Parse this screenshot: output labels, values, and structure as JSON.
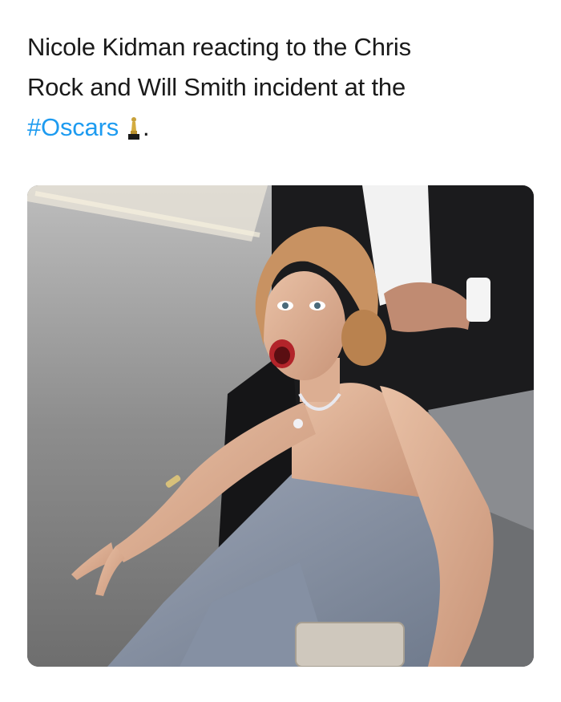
{
  "tweet": {
    "text_line_1": "Nicole Kidman reacting to the Chris",
    "text_line_2": "Rock and Will Smith incident at the",
    "hashtag": "#Oscars",
    "trailing": ".",
    "emoji": "oscar-trophy-icon"
  },
  "media": {
    "type": "photo",
    "icon": "photo"
  },
  "colors": {
    "text": "#1a1a1a",
    "hashtag": "#1d9bf0",
    "background": "#ffffff"
  }
}
